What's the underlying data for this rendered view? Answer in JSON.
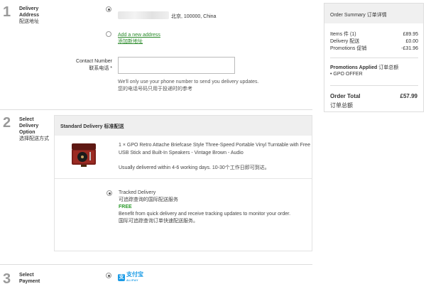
{
  "steps": [
    {
      "number": "1",
      "title": "Delivery Address",
      "title_cn": "配送地址"
    },
    {
      "number": "2",
      "title": "Select Delivery Option",
      "title_cn": "选择配送方式"
    },
    {
      "number": "3",
      "title": "Select Payment",
      "title_cn": ""
    }
  ],
  "address": {
    "text": "北京, 100000, China",
    "add_new_label": "Add a new address",
    "add_new_label_cn": "添加新地址"
  },
  "contact": {
    "label": "Contact Number",
    "label_cn": "联系电话 *",
    "value": "",
    "hint": "We'll only use your phone number to send you delivery updates.",
    "hint_cn": "您的电话号码只用于投递时的参考"
  },
  "delivery": {
    "header": "Standard Delivery 标准配送",
    "product": "1 × GPO Retro Attache Briefcase Style Three-Speed Portable Vinyl Turntable with Free USB Stick and Built-In Speakers - Vintage Brown - Audio",
    "usual": "Usually delivered within 4-6 working days. 10-30个工作日即可到达。",
    "tracked_title": "Tracked Delivery",
    "tracked_title_cn": "可追踪查询的国际配送服务",
    "tracked_price": "FREE",
    "tracked_desc": "Benefit from quick delivery and receive tracking updates to monitor your order.",
    "tracked_desc_cn": "国际可追踪查询订单快速配送服务。"
  },
  "payment": {
    "logo_text": "支付宝",
    "logo_sub": "ALIPAY",
    "logo_mark": "支"
  },
  "summary": {
    "title": "Order Summary 订单详情",
    "rows": [
      {
        "label": "Items 件 (1)",
        "value": "£89.95"
      },
      {
        "label": "Delivery 配送",
        "value": "£0.00"
      },
      {
        "label": "Promotions 促销",
        "value": "-£31.96"
      }
    ],
    "promo_title": "Promotions Applied",
    "promo_title_cn": "订单总额",
    "promo_item": "GPO OFFER",
    "total_label": "Order Total",
    "total_label_cn": "订单总额",
    "total_value": "£57.99"
  },
  "colors": {
    "link": "#2a8a2a",
    "free": "#2a9a2a",
    "alipay": "#1a9be6"
  }
}
